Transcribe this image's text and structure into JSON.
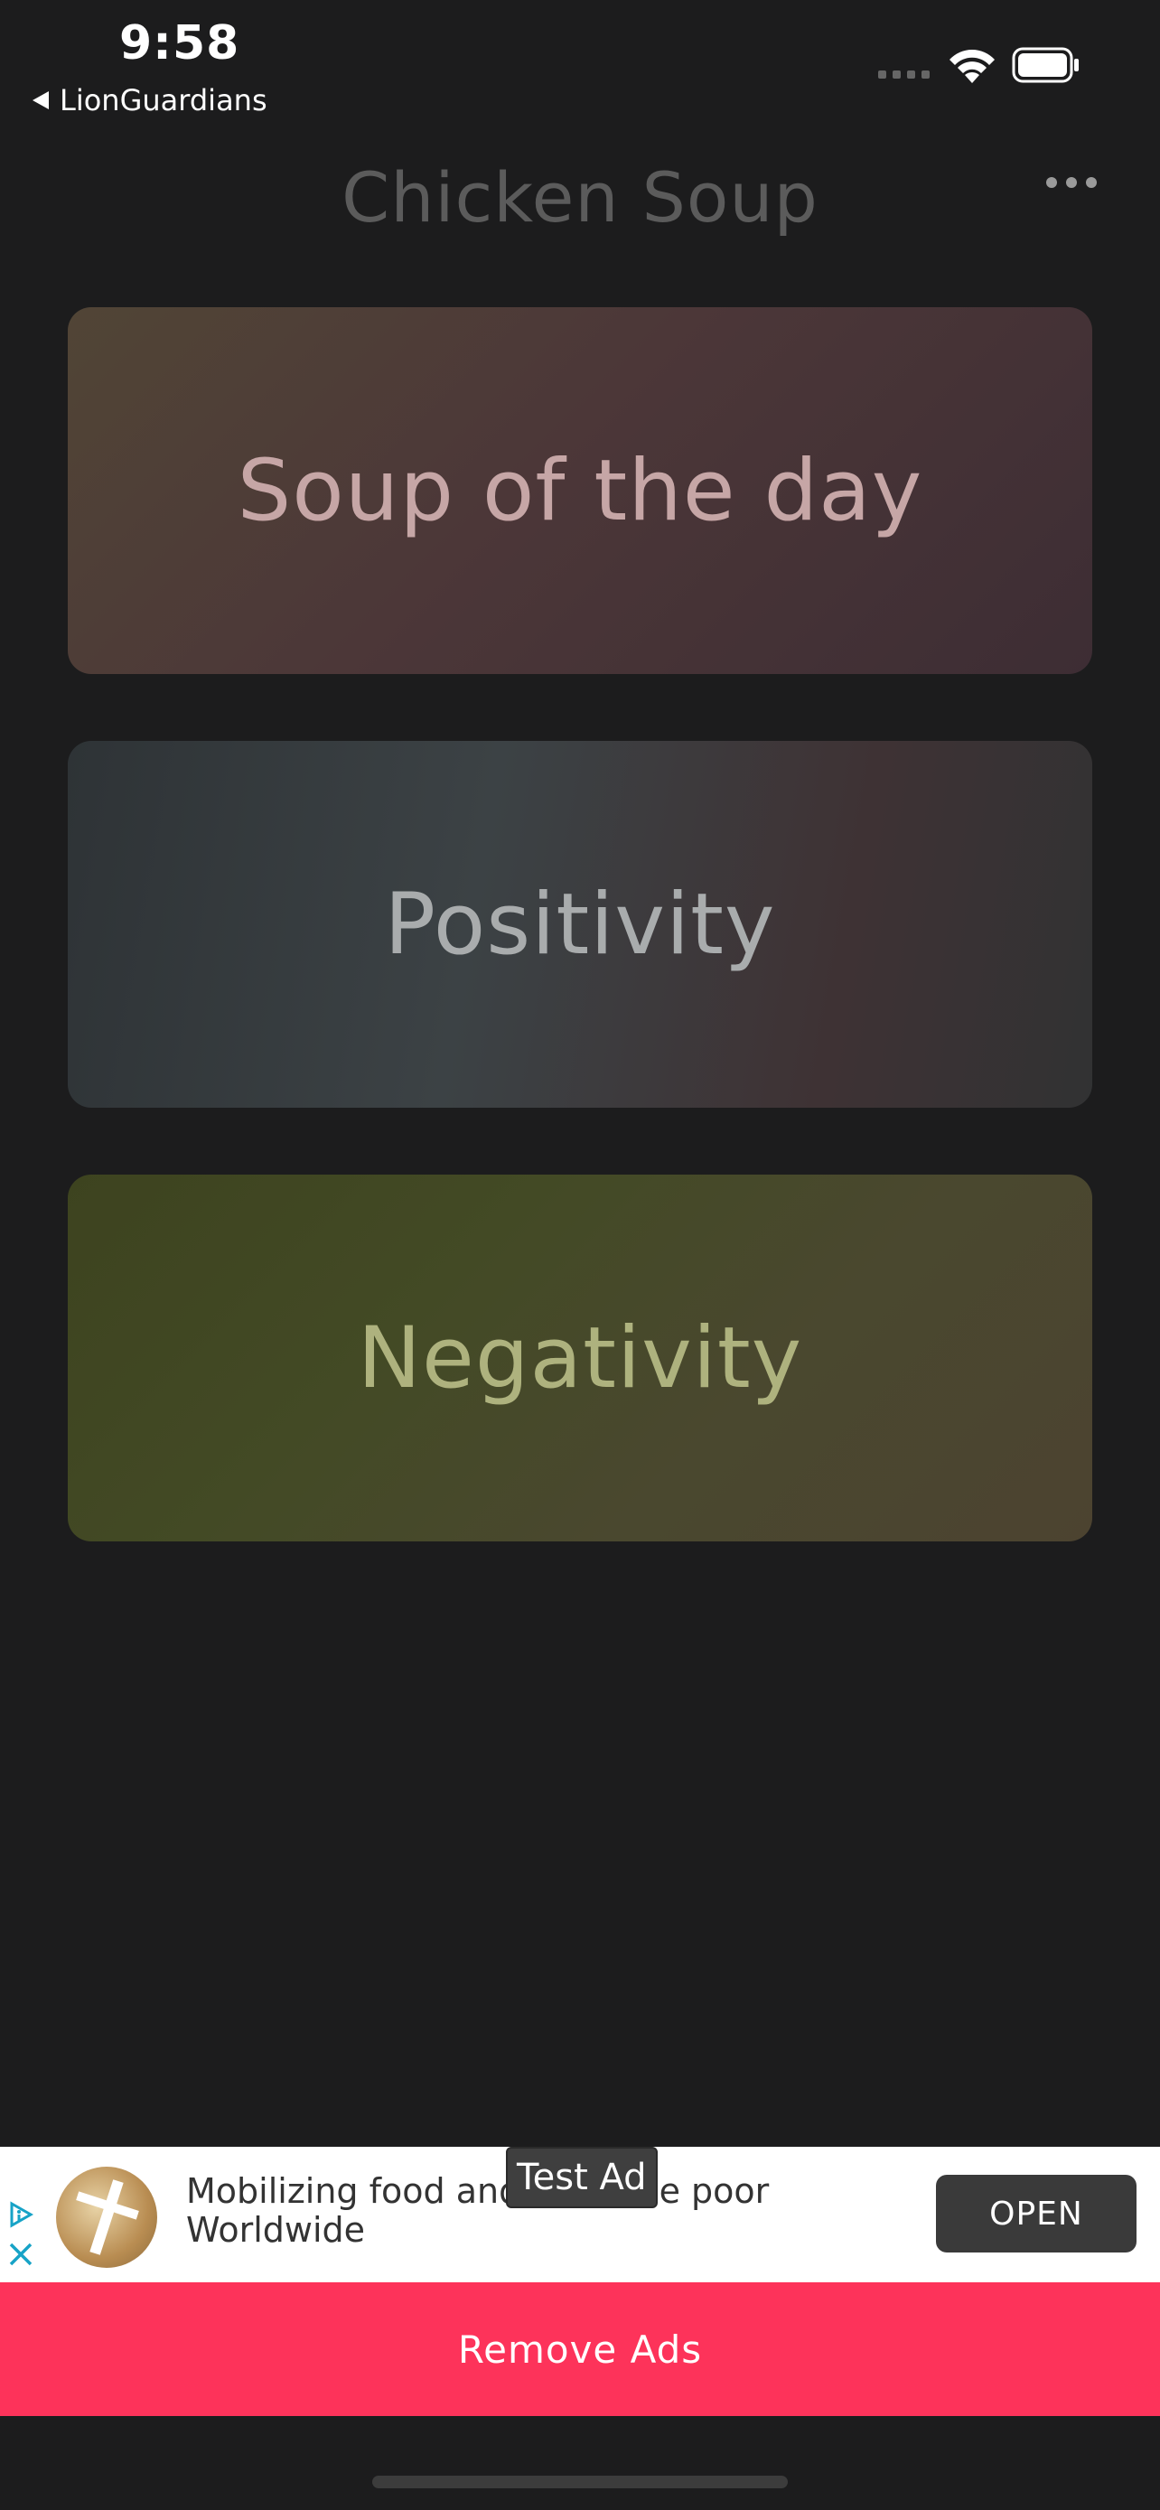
{
  "status_bar": {
    "time": "9:58",
    "back_app": "LionGuardians"
  },
  "nav": {
    "title": "Chicken Soup"
  },
  "cards": [
    {
      "label": "Soup of the day"
    },
    {
      "label": "Positivity"
    },
    {
      "label": "Negativity"
    }
  ],
  "ad": {
    "label": "Test Ad",
    "text": "Mobilizing food and… for the poor Worldwide",
    "open_label": "OPEN"
  },
  "remove_ads_label": "Remove Ads",
  "colors": {
    "remove_ads_bg": "#fd335a",
    "background": "#1c1c1d"
  }
}
